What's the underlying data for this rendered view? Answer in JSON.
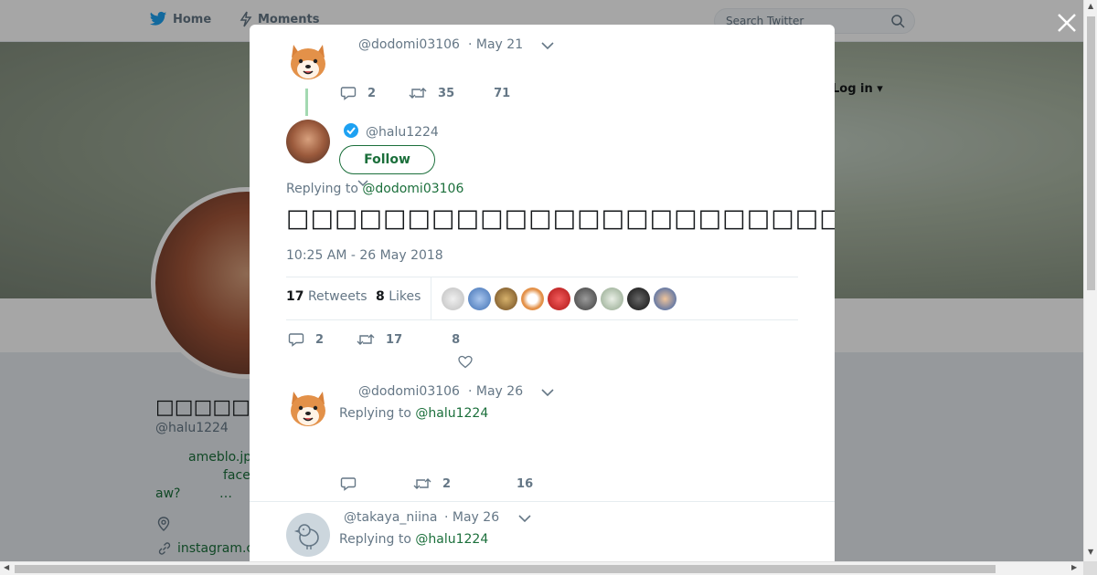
{
  "nav": {
    "home_label": "Home",
    "moments_label": "Moments",
    "search_placeholder": "Search Twitter",
    "login_label": "Log in"
  },
  "profile": {
    "name": "□□□□□",
    "handle": "@halu1224",
    "bio_line1": "ameblo.jp",
    "bio_line2": "face",
    "bio_line3": "aw?",
    "bio_line4": "…",
    "link": "instagram.c"
  },
  "modal": {
    "parent_tweet": {
      "handle": "@dodomi03106",
      "date": "· May 21",
      "replies": "2",
      "retweets": "35",
      "likes": "71"
    },
    "main_tweet": {
      "handle": "@halu1224",
      "follow_label": "Follow",
      "replying_prefix": "Replying to",
      "replying_to": "@dodomi03106",
      "text": "□□□□□□□□□□□□□□□□□□□□□□□□□□□□□□□□□□",
      "timestamp": "10:25 AM - 26 May 2018",
      "retweets_count": "17",
      "retweets_label": "Retweets",
      "likes_count": "8",
      "likes_label": "Likes",
      "replies": "2",
      "retweets": "17",
      "likes": "8"
    },
    "reply_1": {
      "handle": "@dodomi03106",
      "date": "· May 26",
      "replying_prefix": "Replying to",
      "replying_to": "@halu1224",
      "retweets": "2",
      "likes": "16"
    },
    "reply_2": {
      "handle": "@takaya_niina",
      "date": "· May 26",
      "replying_prefix": "Replying to",
      "replying_to": "@halu1224"
    }
  },
  "colors": {
    "accent_link": "#1b6f3b",
    "verified": "#1da1f2",
    "muted_text": "#657786"
  }
}
